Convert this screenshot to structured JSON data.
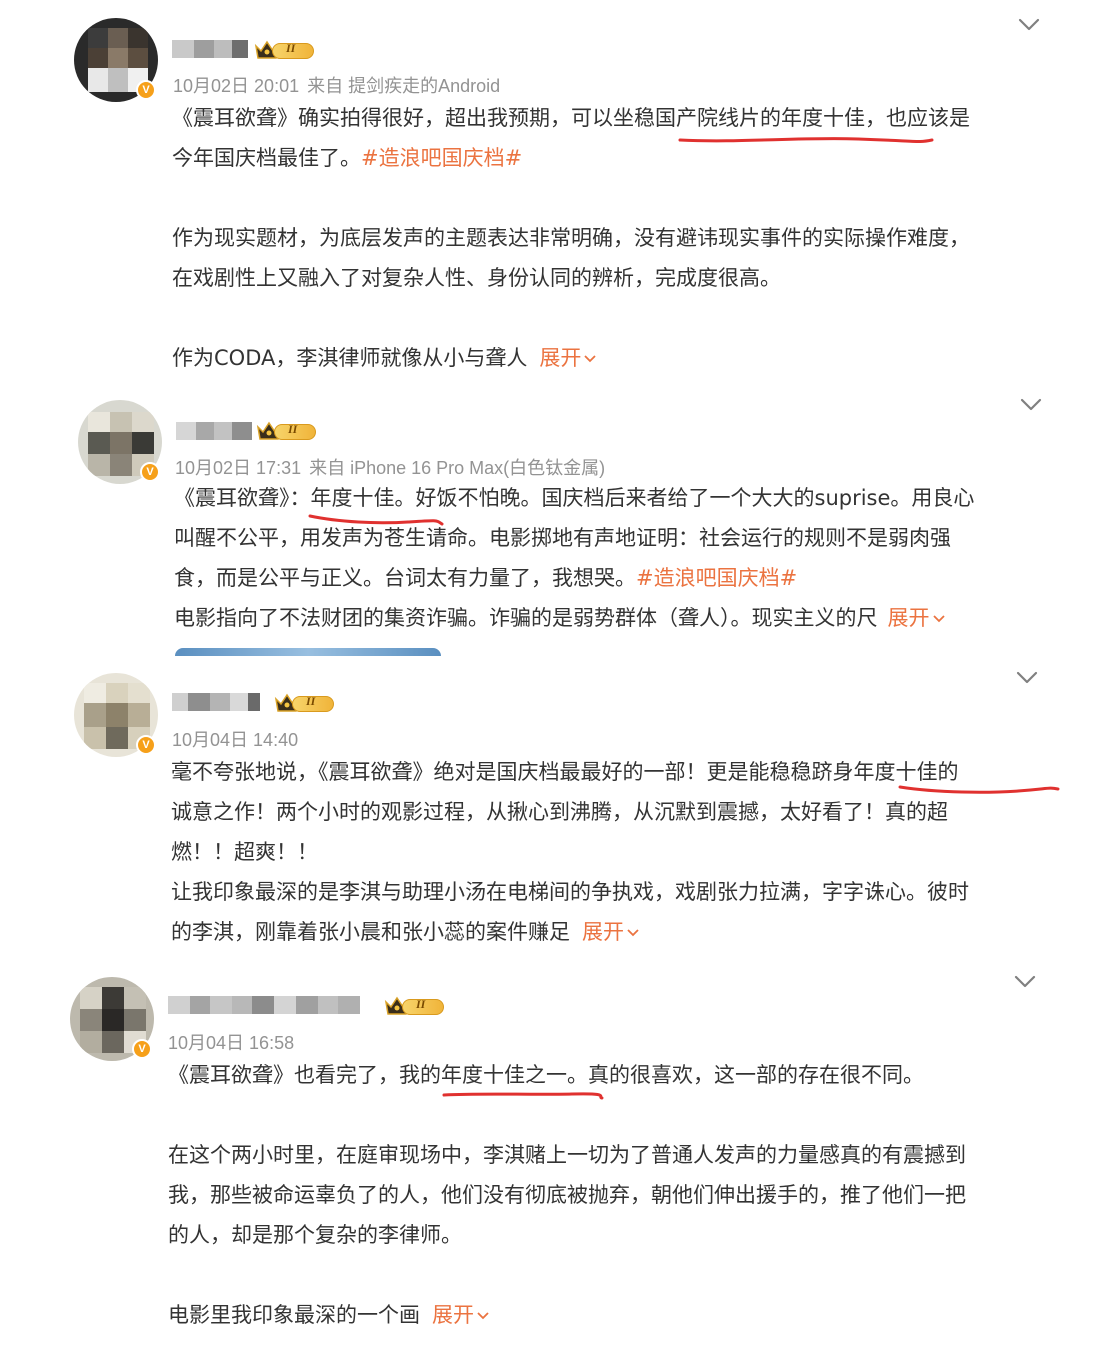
{
  "posts": [
    {
      "meta_time": "10月02日 20:01",
      "meta_source": "来自 提剑疾走的Android",
      "vip_level": "II",
      "lines": [
        [
          "《震耳欲聋》确实拍得很好，超出我预期，可以坐稳国产院线片的年度十佳，也应该是"
        ],
        [
          "今年国庆档最佳了。",
          "#造浪吧国庆档#"
        ],
        [
          ""
        ],
        [
          "作为现实题材，为底层发声的主题表达非常明确，没有避讳现实事件的实际操作难度，"
        ],
        [
          "在戏剧性上又融入了对复杂人性、身份认同的辨析，完成度很高。"
        ],
        [
          ""
        ],
        [
          "作为CODA，李淇律师就像从小与聋人",
          "展开"
        ]
      ]
    },
    {
      "meta_time": "10月02日 17:31",
      "meta_source": "来自 iPhone 16 Pro Max(白色钛金属)",
      "vip_level": "II",
      "lines": [
        [
          "《震耳欲聋》：年度十佳。好饭不怕晚。国庆档后来者给了一个大大的suprise。用良心"
        ],
        [
          "叫醒不公平，用发声为苍生请命。电影掷地有声地证明：社会运行的规则不是弱肉强"
        ],
        [
          "食，而是公平与正义。台词太有力量了，我想哭。",
          "#造浪吧国庆档#"
        ],
        [
          "电影指向了不法财团的集资诈骗。诈骗的是弱势群体（聋人）。现实主义的尺",
          "展开"
        ]
      ]
    },
    {
      "meta_time": "10月04日 14:40",
      "meta_source": "",
      "vip_level": "II",
      "lines": [
        [
          "毫不夸张地说，《震耳欲聋》绝对是国庆档最最好的一部！更是能稳稳跻身年度十佳的"
        ],
        [
          "诚意之作！两个小时的观影过程，从揪心到沸腾，从沉默到震撼，太好看了！真的超"
        ],
        [
          "燃！！超爽！！"
        ],
        [
          "让我印象最深的是李淇与助理小汤在电梯间的争执戏，戏剧张力拉满，字字诛心。彼时"
        ],
        [
          "的李淇，刚靠着张小晨和张小蕊的案件赚足",
          "展开"
        ]
      ]
    },
    {
      "meta_time": "10月04日 16:58",
      "meta_source": "",
      "vip_level": "II",
      "lines": [
        [
          "《震耳欲聋》也看完了，我的年度十佳之一。真的很喜欢，这一部的存在很不同。"
        ],
        [
          ""
        ],
        [
          "在这个两小时里，在庭审现场中，李淇赌上一切为了普通人发声的力量感真的有震撼到"
        ],
        [
          "我，那些被命运辜负了的人，他们没有彻底被抛弃，朝他们伸出援手的，推了他们一把"
        ],
        [
          "的人，却是那个复杂的李律师。"
        ],
        [
          ""
        ],
        [
          "电影里我印象最深的一个画",
          "展开"
        ]
      ]
    }
  ],
  "colors": {
    "accent": "#eb7340",
    "underline": "#e0312f",
    "text": "#333333",
    "meta": "#939393"
  },
  "icons": {
    "collapse": "chevron-down-icon",
    "vip": "crown-icon",
    "verified": "verified-v-icon"
  },
  "verified_label": "V"
}
